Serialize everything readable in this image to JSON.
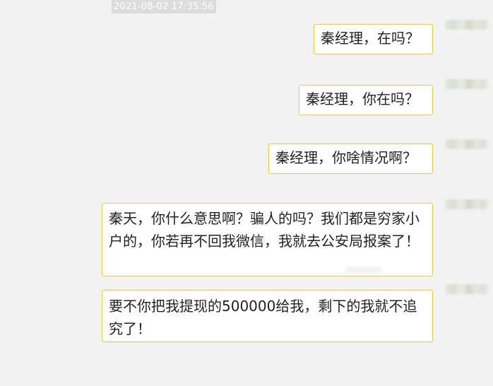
{
  "chat": {
    "timestamp": "2021-08-02 17:35:56",
    "messages": [
      {
        "text": "秦经理，在吗？"
      },
      {
        "text": "秦经理，你在吗？"
      },
      {
        "text": "秦经理，你啥情况啊？"
      },
      {
        "text": "秦天，你什么意思啊？骗人的吗？我们都是穷家小户的，你若再不回我微信，我就去公安局报案了！"
      },
      {
        "text": "要不你把我提现的500000给我，剩下的我就不追究了！"
      }
    ]
  }
}
